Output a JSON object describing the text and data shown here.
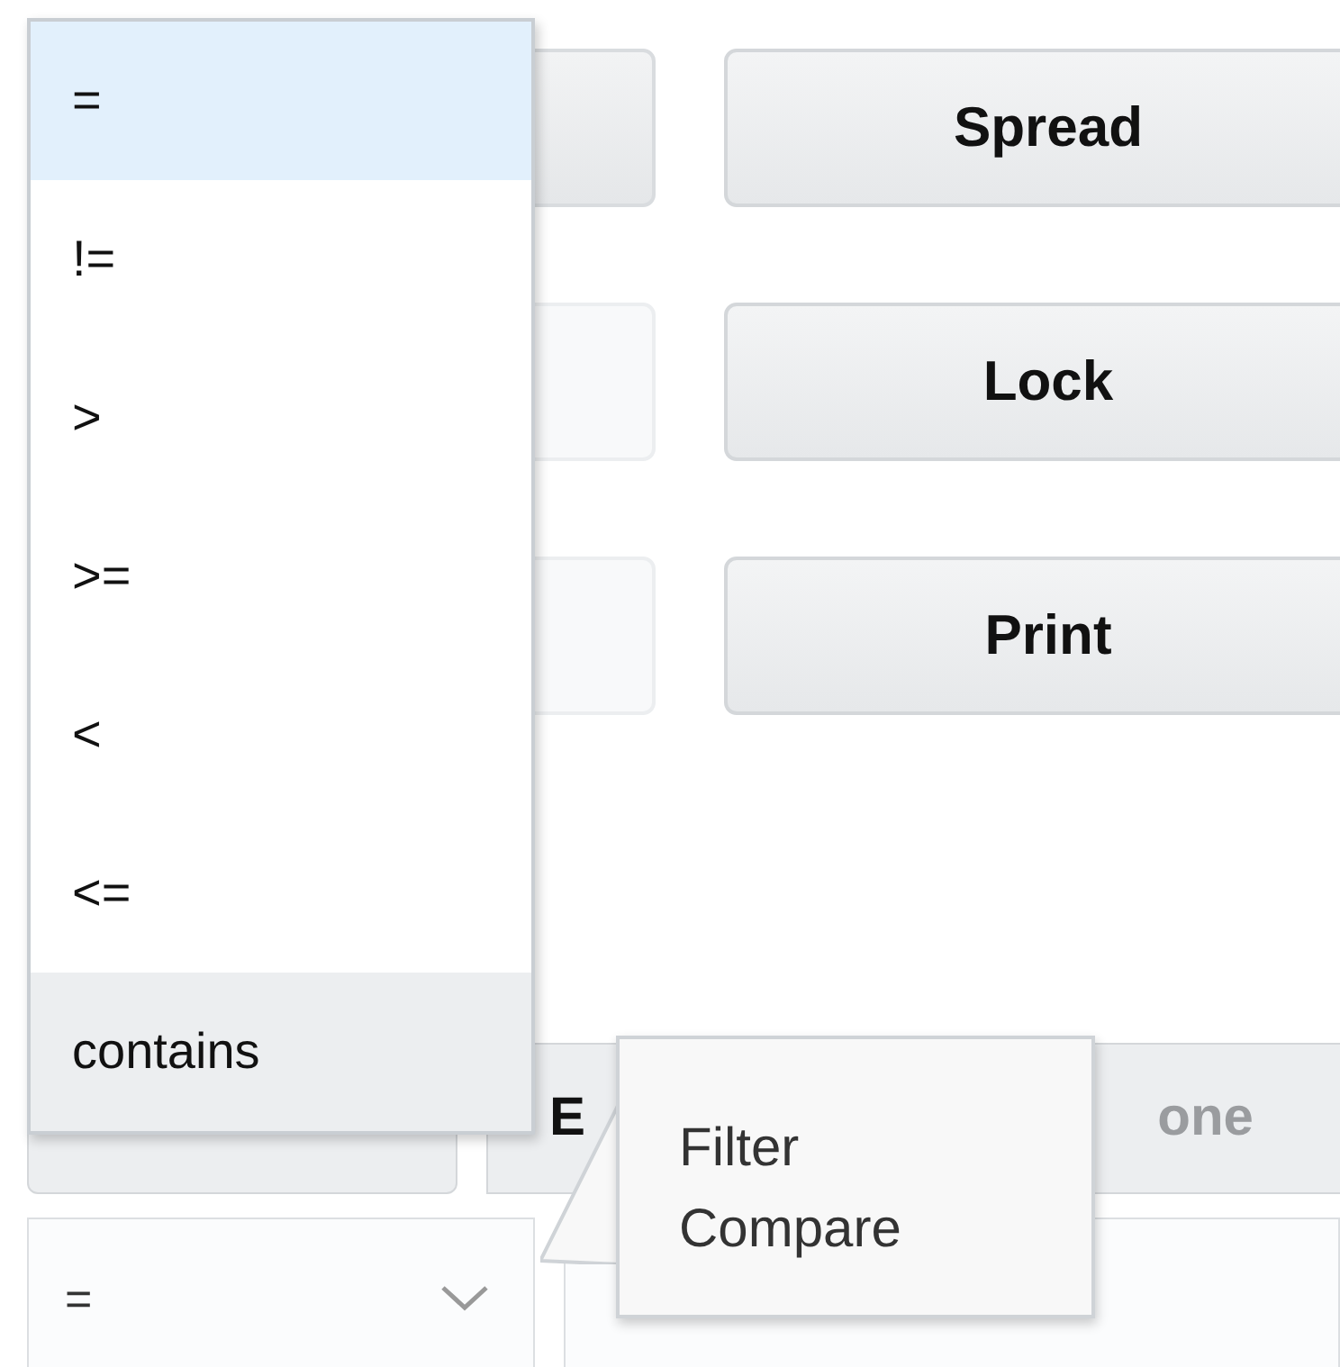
{
  "left_buttons": [
    {
      "disabled": false
    },
    {
      "disabled": true
    },
    {
      "disabled": true
    }
  ],
  "right_buttons": [
    {
      "label": "Spread"
    },
    {
      "label": "Lock"
    },
    {
      "label": "Print"
    }
  ],
  "segment_bar": [
    {
      "label": "E",
      "disabled": false
    },
    {
      "label": "one",
      "disabled": true
    }
  ],
  "compare_select": {
    "value": "="
  },
  "dropdown": {
    "options": [
      {
        "label": "=",
        "selected": true,
        "hovered": false
      },
      {
        "label": "!=",
        "selected": false,
        "hovered": false
      },
      {
        "label": ">",
        "selected": false,
        "hovered": false
      },
      {
        "label": ">=",
        "selected": false,
        "hovered": false
      },
      {
        "label": "<",
        "selected": false,
        "hovered": false
      },
      {
        "label": "<=",
        "selected": false,
        "hovered": false
      },
      {
        "label": "contains",
        "selected": false,
        "hovered": true
      }
    ]
  },
  "tooltip": {
    "lines": [
      "Filter",
      "Compare"
    ]
  }
}
